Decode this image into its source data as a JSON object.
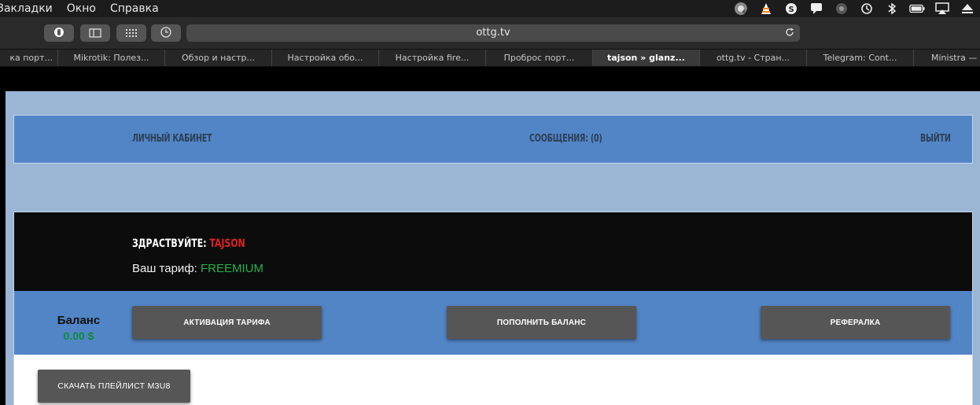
{
  "menubar": {
    "items": [
      "Закладки",
      "Окно",
      "Справка"
    ],
    "status_icons": [
      "cpu-monitor-icon",
      "vlc-icon",
      "skype-icon",
      "notification-icon",
      "vpn-icon",
      "time-machine-icon",
      "bluetooth-icon",
      "battery-icon",
      "airplay-icon",
      "eject-icon"
    ]
  },
  "toolbar": {
    "buttons": [
      "reader-icon",
      "sidebar-icon",
      "grid-icon",
      "history-icon"
    ],
    "address": "ottg.tv"
  },
  "tabs": [
    {
      "label": "ка порт..."
    },
    {
      "label": "Mikrotik: Полез..."
    },
    {
      "label": "Обзор и настр..."
    },
    {
      "label": "Настройка обо..."
    },
    {
      "label": "Настройка fire..."
    },
    {
      "label": "Проброс порт..."
    },
    {
      "label": "tajson » glanz...",
      "active": true
    },
    {
      "label": "ottg.tv - Стран..."
    },
    {
      "label": "Telegram: Cont..."
    },
    {
      "label": "Ministra — м"
    }
  ],
  "nav": {
    "account": "ЛИЧНЫЙ КАБИНЕТ",
    "messages": "СООБЩЕНИЯ: (0)",
    "logout": "ВЫЙТИ"
  },
  "welcome": {
    "greeting": "ЗДРАСТВУЙТЕ: ",
    "username": "TAJSON",
    "tariff_label": "Ваш тариф: ",
    "tariff_value": "FREEMIUM"
  },
  "balance": {
    "label": "Баланс",
    "amount": "0.00 $"
  },
  "actions": {
    "activate": "АКТИВАЦИЯ ТАРИФА",
    "topup": "ПОПОЛНИТЬ БАЛАНС",
    "referral": "РЕФЕРАЛКА",
    "playlist": "СКАЧАТЬ ПЛЕЙЛИСТ M3U8"
  },
  "colors": {
    "nav_bg": "#5285c6",
    "page_bg": "#9bb5d5",
    "username": "#e02020",
    "tariff": "#22b24c",
    "balance_amount": "#118a3c",
    "button_bg": "#565656"
  }
}
